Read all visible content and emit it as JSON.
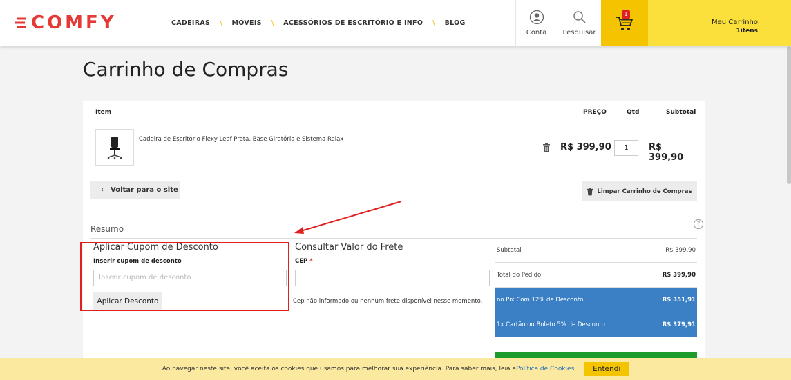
{
  "header": {
    "logo": "COMFY",
    "nav": [
      "CADEIRAS",
      "MÓVEIS",
      "ACESSÓRIOS DE ESCRITÓRIO E INFO",
      "BLOG"
    ],
    "account_label": "Conta",
    "search_label": "Pesquisar",
    "cart_badge": "1",
    "mycart_label": "Meu Carrinho",
    "mycart_count": "1itens"
  },
  "page": {
    "title": "Carrinho de Compras"
  },
  "table": {
    "headers": {
      "item": "Item",
      "price": "PREÇO",
      "qty": "Qtd",
      "subtotal": "Subtotal"
    },
    "rows": [
      {
        "name": "Cadeira de Escritório Flexy Leaf Preta, Base Giratória e Sistema Relax",
        "price": "R$ 399,90",
        "qty": "1",
        "subtotal": "R$ 399,90"
      }
    ]
  },
  "actions": {
    "back": "Voltar para o site",
    "clear": "Limpar Carrinho de Compras"
  },
  "summary": {
    "title": "Resumo",
    "coupon": {
      "title": "Aplicar Cupom de Desconto",
      "label": "Inserir cupom de desconto",
      "placeholder": "Inserir cupom de desconto",
      "button": "Aplicar Desconto"
    },
    "shipping": {
      "title": "Consultar Valor do Frete",
      "label": "CEP",
      "required_mark": "*",
      "message": "Cep não informado ou nenhum frete disponível nesse momento."
    },
    "totals": [
      {
        "label": "Subtotal",
        "value": "R$ 399,90"
      },
      {
        "label": "Total do Pedido",
        "value": "R$ 399,90"
      },
      {
        "label": "no Pix Com 12% de Desconto",
        "value": "R$ 351,91"
      },
      {
        "label": "1x Cartão ou Boleto 5% de Desconto",
        "value": "R$ 379,91"
      }
    ]
  },
  "cookie": {
    "text": "Ao navegar neste site, você aceita os cookies que usamos para melhorar sua experiência. Para saber mais, leia a ",
    "link": "Política de Cookies",
    "suffix": ".",
    "button": "Entendi"
  },
  "colors": {
    "brand_red": "#e53935",
    "cart_yellow": "#f4c400",
    "total_blue": "#3b7fc4",
    "checkout_green": "#1c9a2c"
  }
}
